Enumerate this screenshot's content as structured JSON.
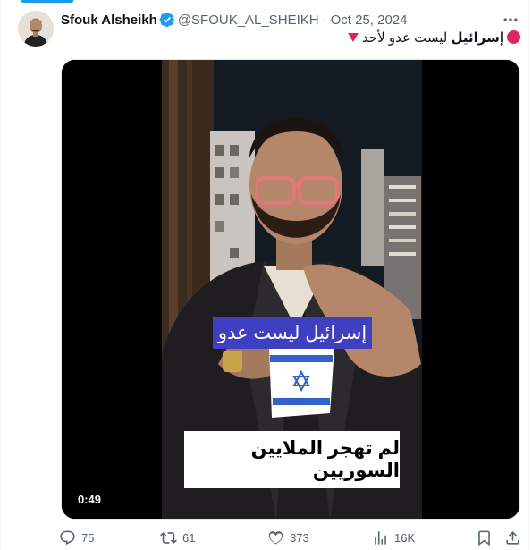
{
  "tweet": {
    "author_name": "Sfouk Alsheikh",
    "handle": "@SFOUK_AL_SHEIKH",
    "separator": "·",
    "date": "Oct 25, 2024",
    "text": "إسرائيل ليست عدو لأحد",
    "text_bold_part": "إسرائيل",
    "text_rest": " ليست عدو لأحد"
  },
  "video": {
    "duration": "0:49",
    "caption_top": "إسرائيل ليست عدو",
    "caption_bottom": "لم تهجر الملايين السوريين"
  },
  "actions": {
    "reply_count": "75",
    "retweet_count": "61",
    "like_count": "373",
    "view_count": "16K"
  },
  "colors": {
    "accent": "#1d9bf0",
    "emoji_red": "#e0245e",
    "caption_blue": "#3f3fc1",
    "muted": "#536471"
  },
  "icons": [
    "verified-badge-icon",
    "more-icon",
    "reply-icon",
    "retweet-icon",
    "like-icon",
    "views-icon",
    "bookmark-icon",
    "share-icon"
  ]
}
